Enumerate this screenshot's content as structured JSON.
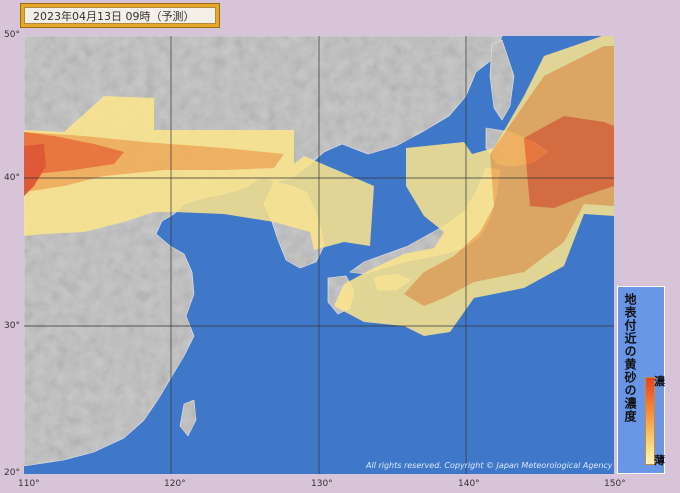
{
  "title": "2023年04月13日 09時（予測）",
  "latitude_labels": [
    "50°",
    "40°",
    "30°",
    "20°"
  ],
  "longitude_labels": [
    "110°",
    "120°",
    "130°",
    "140°",
    "150°"
  ],
  "legend": {
    "title": "地表付近の黄砂の濃度",
    "high_label": "濃",
    "low_label": "薄"
  },
  "copyright": "All rights reserved. Copyright © Japan Meteorological Agency",
  "colors": {
    "sea": "#3f78c8",
    "land": "#c9c9c9",
    "dust_light": "#fde68c",
    "dust_medium": "#f7ae52",
    "dust_heavy": "#ef6a2a",
    "grid": "#333333"
  }
}
